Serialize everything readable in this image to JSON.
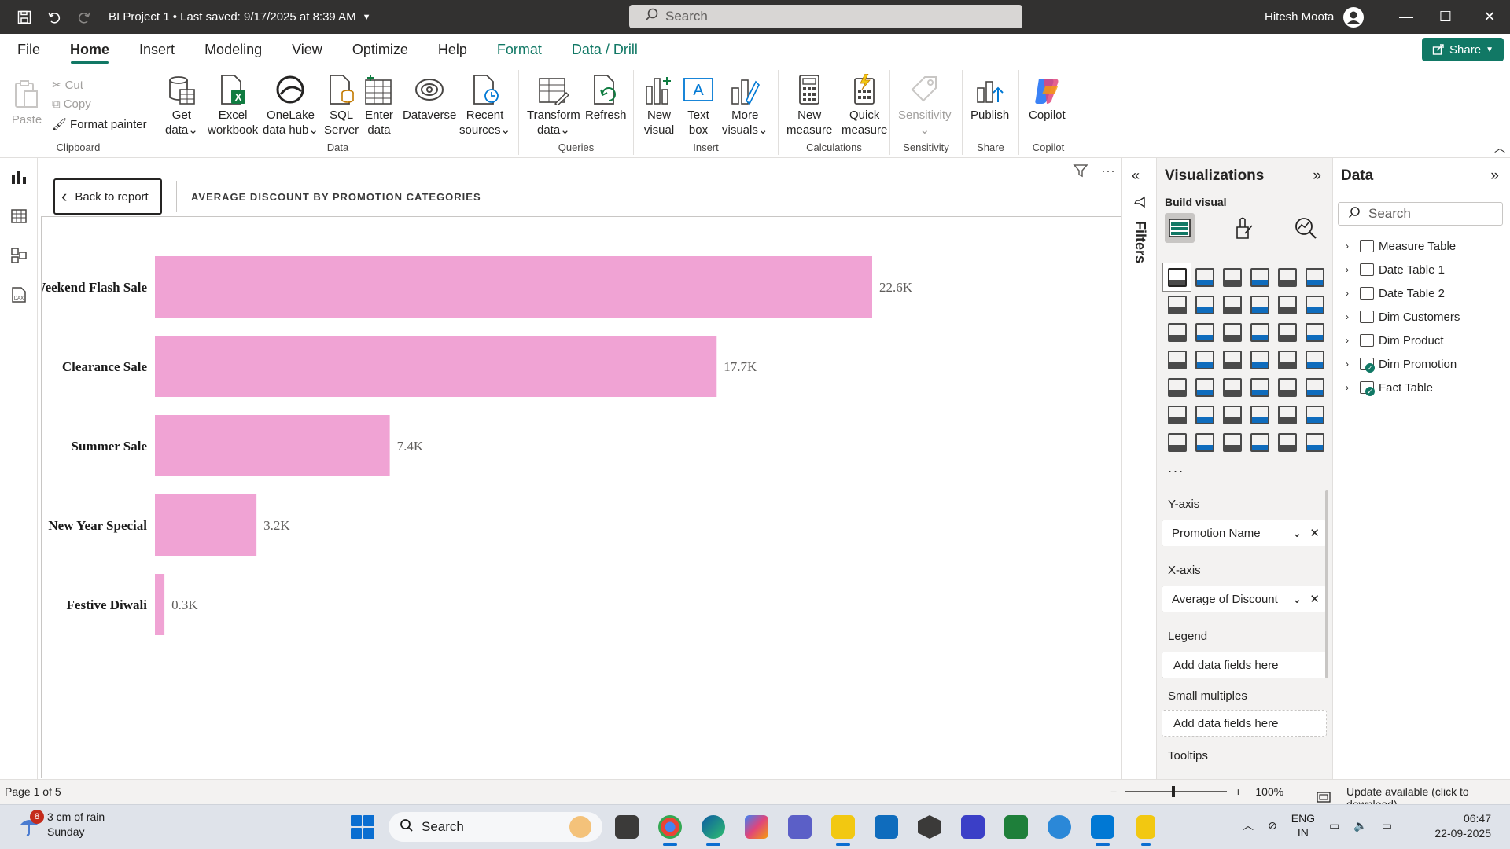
{
  "titlebar": {
    "title": "BI Project 1 • Last saved: 9/17/2025 at 8:39 AM",
    "search_placeholder": "Search",
    "user": "Hitesh Moota"
  },
  "menu": {
    "tabs": [
      "File",
      "Home",
      "Insert",
      "Modeling",
      "View",
      "Optimize",
      "Help",
      "Format",
      "Data / Drill"
    ],
    "active": "Home",
    "share_label": "Share"
  },
  "ribbon": {
    "clipboard": {
      "paste": "Paste",
      "cut": "Cut",
      "copy": "Copy",
      "format_painter": "Format painter",
      "label": "Clipboard"
    },
    "data": {
      "get_data": [
        "Get",
        "data"
      ],
      "excel": [
        "Excel",
        "workbook"
      ],
      "onelake": [
        "OneLake",
        "data hub"
      ],
      "sql": [
        "SQL",
        "Server"
      ],
      "enter": [
        "Enter",
        "data"
      ],
      "dataverse": [
        "Dataverse",
        ""
      ],
      "recent": [
        "Recent",
        "sources"
      ],
      "label": "Data"
    },
    "queries": {
      "transform": [
        "Transform",
        "data"
      ],
      "refresh": [
        "Refresh",
        ""
      ],
      "label": "Queries"
    },
    "insert": {
      "new_visual": [
        "New",
        "visual"
      ],
      "text_box": [
        "Text",
        "box"
      ],
      "more_visuals": [
        "More",
        "visuals"
      ],
      "label": "Insert"
    },
    "calculations": {
      "new_measure": [
        "New",
        "measure"
      ],
      "quick_measure": [
        "Quick",
        "measure"
      ],
      "label": "Calculations"
    },
    "sensitivity": {
      "button": "Sensitivity",
      "label": "Sensitivity"
    },
    "share": {
      "publish": "Publish",
      "label": "Share"
    },
    "copilot": {
      "button": "Copilot",
      "label": "Copilot"
    }
  },
  "canvas": {
    "back_label": "Back to report",
    "title": "AVERAGE DISCOUNT BY PROMOTION CATEGORIES"
  },
  "chart_data": {
    "type": "bar",
    "orientation": "horizontal",
    "title": "AVERAGE DISCOUNT BY PROMOTION CATEGORIES",
    "categories": [
      "Weekend Flash Sale",
      "Clearance Sale",
      "Summer Sale",
      "New Year Special",
      "Festive Diwali"
    ],
    "values": [
      22600,
      17700,
      7400,
      3200,
      300
    ],
    "data_labels": [
      "22.6K",
      "17.7K",
      "7.4K",
      "3.2K",
      "0.3K"
    ],
    "xlim": [
      0,
      22600
    ],
    "color": "#f0a3d4",
    "grid": false
  },
  "filters": {
    "label": "Filters"
  },
  "visualizations": {
    "title": "Visualizations",
    "build_label": "Build visual",
    "more": "...",
    "wells": {
      "y_axis": {
        "label": "Y-axis",
        "value": "Promotion Name"
      },
      "x_axis": {
        "label": "X-axis",
        "value": "Average of Discount"
      },
      "legend": {
        "label": "Legend",
        "placeholder": "Add data fields here"
      },
      "small_multiples": {
        "label": "Small multiples",
        "placeholder": "Add data fields here"
      },
      "tooltips": {
        "label": "Tooltips"
      }
    }
  },
  "data_pane": {
    "title": "Data",
    "search_placeholder": "Search",
    "tables": [
      "Measure Table",
      "Date Table 1",
      "Date Table 2",
      "Dim Customers",
      "Dim Product",
      "Dim Promotion",
      "Fact Table"
    ]
  },
  "statusbar": {
    "page": "Page 1 of 5",
    "zoom": "100%",
    "update": "Update available (click to download)"
  },
  "taskbar": {
    "weather_badge": "8",
    "weather_line1": "3 cm of rain",
    "weather_line2": "Sunday",
    "search_placeholder": "Search",
    "lang_line1": "ENG",
    "lang_line2": "IN",
    "time": "06:47",
    "date": "22-09-2025"
  }
}
